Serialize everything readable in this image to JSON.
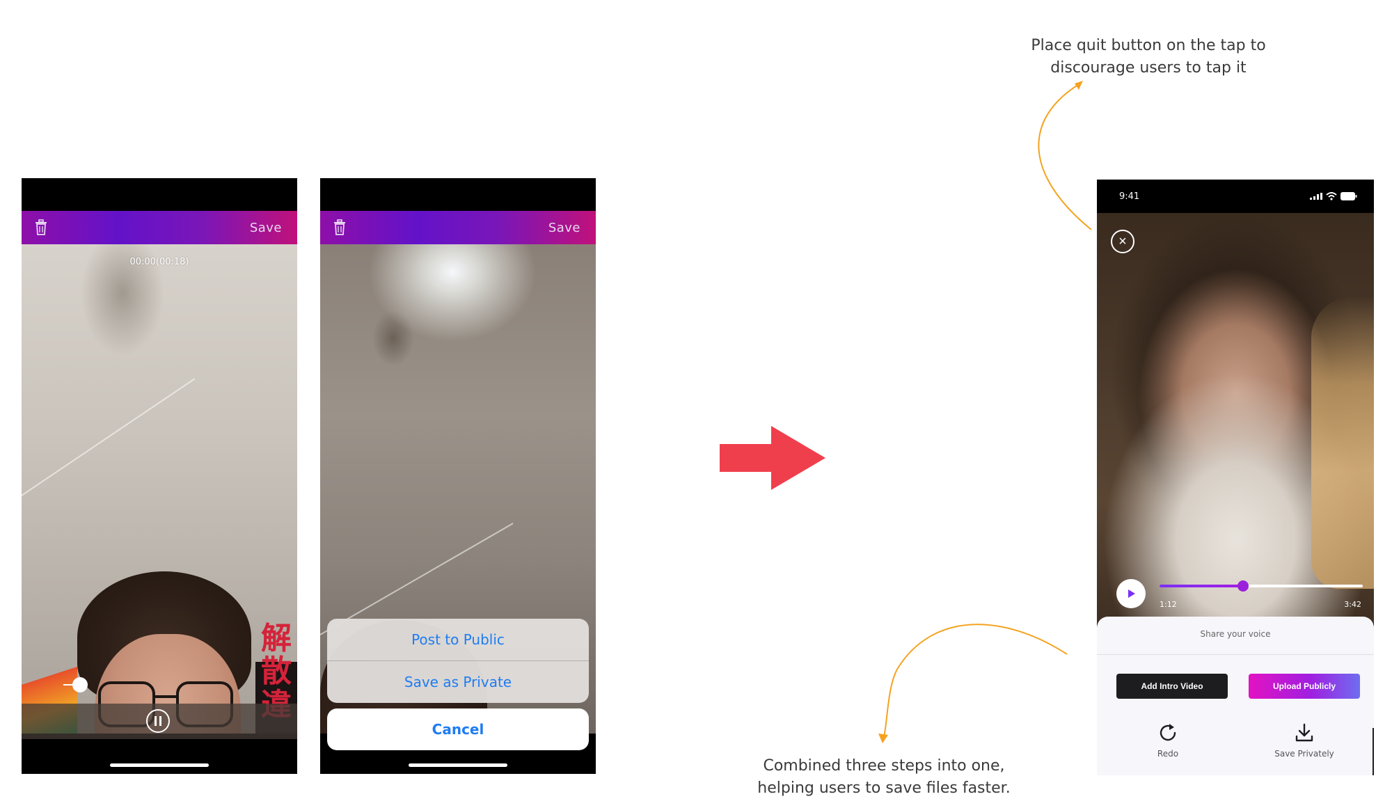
{
  "old_screen_recording": {
    "save_label": "Save",
    "timer": "00:00(00:18)",
    "icons": {
      "trash": "trash-icon",
      "pause": "pause-icon"
    }
  },
  "old_screen_action_sheet": {
    "save_label": "Save",
    "post_public": "Post to Public",
    "save_private": "Save as Private",
    "cancel": "Cancel",
    "icons": {
      "trash": "trash-icon"
    }
  },
  "new_screen": {
    "status_time": "9:41",
    "elapsed": "1:12",
    "duration": "3:42",
    "progress_fraction": 0.41,
    "share_title": "Share your voice",
    "add_intro_video": "Add Intro Video",
    "upload_publicly": "Upload Publicly",
    "redo": "Redo",
    "save_privately": "Save Privately",
    "icons": {
      "close": "close-icon",
      "play": "play-icon",
      "redo": "redo-icon",
      "download": "download-icon"
    }
  },
  "annotations": {
    "top_line1": "Place quit button on the tap to",
    "top_line2": "discourage users to tap it",
    "bottom_line1": "Combined three steps into one,",
    "bottom_line2": "helping users to save files faster."
  },
  "colors": {
    "arrow": "#f03f4c",
    "annotation_arrow": "#f5a21e",
    "accent_purple": "#9b20d9",
    "ios_blue": "#1f7cf2"
  }
}
